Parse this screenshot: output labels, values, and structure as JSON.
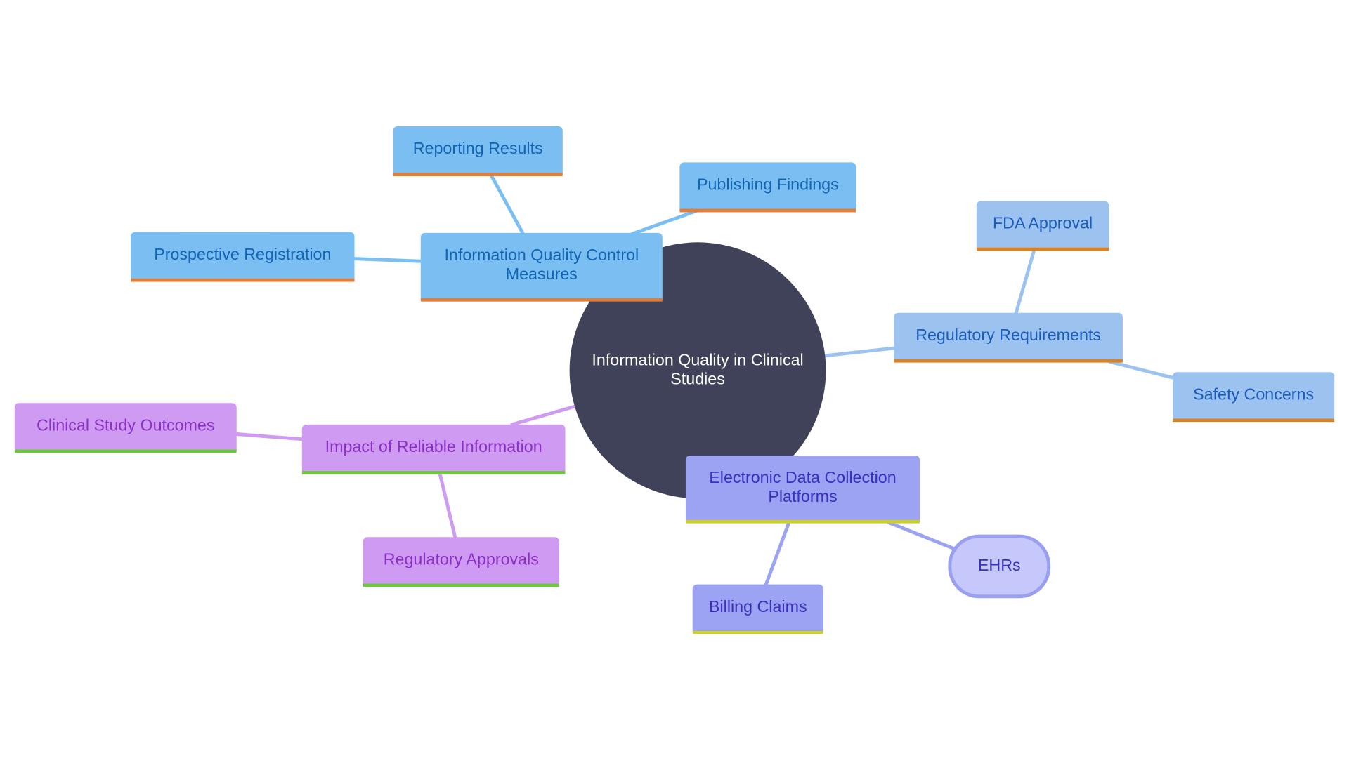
{
  "center": {
    "label": "Information Quality in Clinical Studies",
    "color": "#404259"
  },
  "branches": [
    {
      "label": "Information Quality Control Measures",
      "color": "#7bbff2",
      "children": [
        "Reporting Results",
        "Publishing Findings",
        "Prospective Registration"
      ]
    },
    {
      "label": "Regulatory Requirements",
      "color": "#9cc3ef",
      "children": [
        "FDA Approval",
        "Safety Concerns"
      ]
    },
    {
      "label": "Electronic Data Collection Platforms",
      "color": "#9ba3f2",
      "children": [
        "EHRs",
        "Billing Claims"
      ]
    },
    {
      "label": "Impact of Reliable Information",
      "color": "#cf9bf2",
      "children": [
        "Clinical Study Outcomes",
        "Regulatory Approvals"
      ]
    }
  ]
}
